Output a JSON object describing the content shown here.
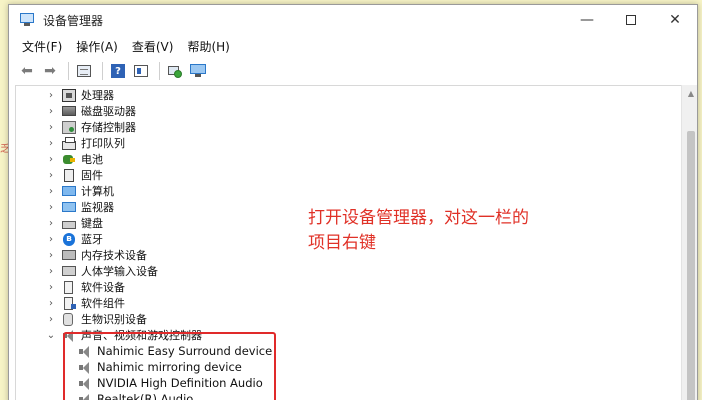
{
  "window": {
    "title": "设备管理器"
  },
  "menu": [
    "文件(F)",
    "操作(A)",
    "查看(V)",
    "帮助(H)"
  ],
  "toolbar": {
    "buttons": [
      "back-icon",
      "forward-icon",
      "show-hide-console-tree-icon",
      "help-icon",
      "properties-icon",
      "scan-hardware-icon",
      "monitor-icon"
    ]
  },
  "tree": {
    "categories": [
      {
        "label": "处理器",
        "icon": "cpu-icon"
      },
      {
        "label": "磁盘驱动器",
        "icon": "disk-icon"
      },
      {
        "label": "存储控制器",
        "icon": "storage-controller-icon"
      },
      {
        "label": "打印队列",
        "icon": "printer-icon"
      },
      {
        "label": "电池",
        "icon": "battery-icon"
      },
      {
        "label": "固件",
        "icon": "firmware-icon"
      },
      {
        "label": "计算机",
        "icon": "computer-icon"
      },
      {
        "label": "监视器",
        "icon": "monitor-icon"
      },
      {
        "label": "键盘",
        "icon": "keyboard-icon"
      },
      {
        "label": "蓝牙",
        "icon": "bluetooth-icon"
      },
      {
        "label": "内存技术设备",
        "icon": "memory-icon"
      },
      {
        "label": "人体学输入设备",
        "icon": "hid-icon"
      },
      {
        "label": "软件设备",
        "icon": "software-device-icon"
      },
      {
        "label": "软件组件",
        "icon": "software-component-icon"
      },
      {
        "label": "生物识别设备",
        "icon": "biometric-icon"
      },
      {
        "label": "声音、视频和游戏控制器",
        "icon": "sound-icon"
      }
    ],
    "sound_children": [
      "Nahimic Easy Surround device",
      "Nahimic mirroring device",
      "NVIDIA High Definition Audio",
      "Realtek(R) Audio"
    ]
  },
  "annotation": {
    "line1": "打开设备管理器，对这一栏的",
    "line2": "项目右键"
  },
  "colors": {
    "annotation": "#e03127",
    "highlight_border": "#e02a2a",
    "background": "#f7f4c6"
  }
}
